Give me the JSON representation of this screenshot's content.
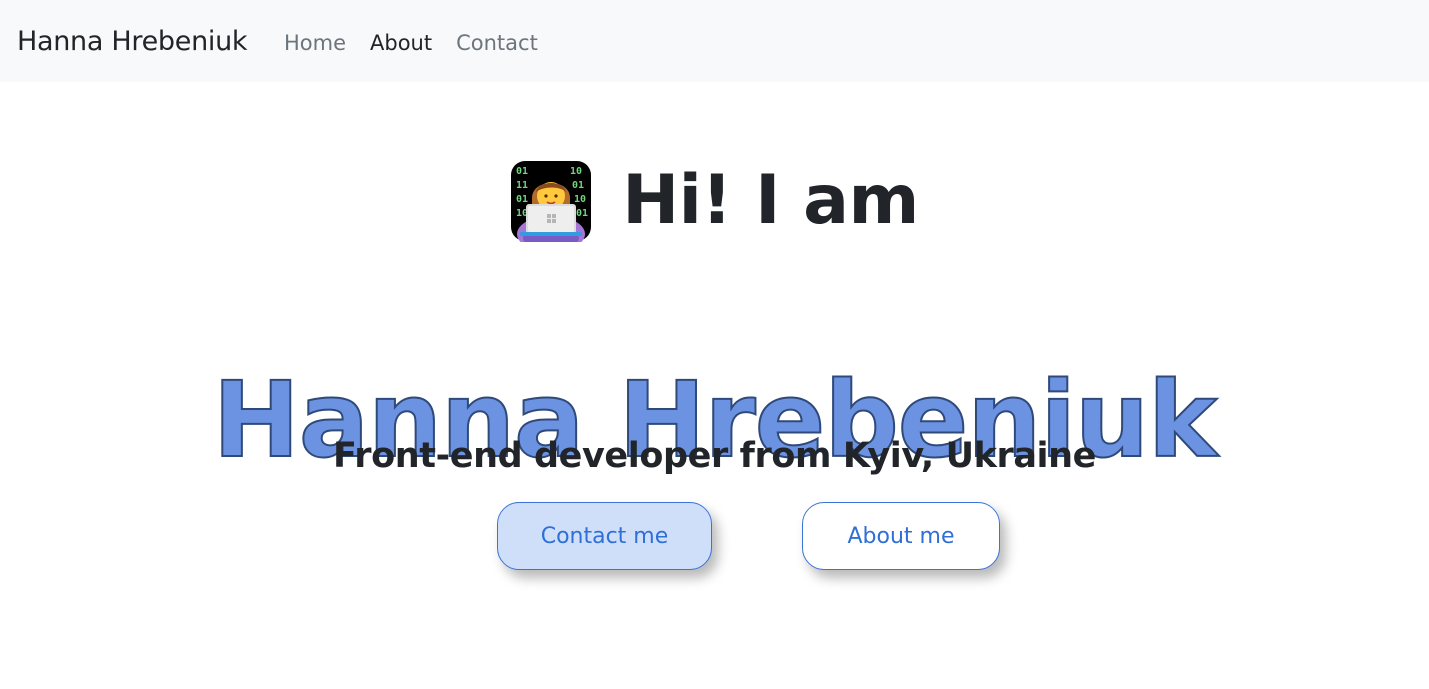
{
  "navbar": {
    "brand": "Hanna Hrebeniuk",
    "links": [
      {
        "label": "Home",
        "active": false
      },
      {
        "label": "About",
        "active": true
      },
      {
        "label": "Contact",
        "active": false
      }
    ]
  },
  "hero": {
    "avatar_icon": "technologist-woman-emoji-icon",
    "greeting": "Hi! I am",
    "name": "Hanna Hrebeniuk",
    "subtitle": "Front-end developer from Kyiv, Ukraine",
    "buttons": {
      "contact_label": "Contact me",
      "about_label": "About me"
    }
  },
  "colors": {
    "navbar_bg": "#f8f9fa",
    "name_fill": "#6b93e2",
    "button_text": "#2f6fd6",
    "contact_button_bg": "#cfdffa",
    "text_dark": "#212529",
    "nav_muted": "#6c757d"
  }
}
